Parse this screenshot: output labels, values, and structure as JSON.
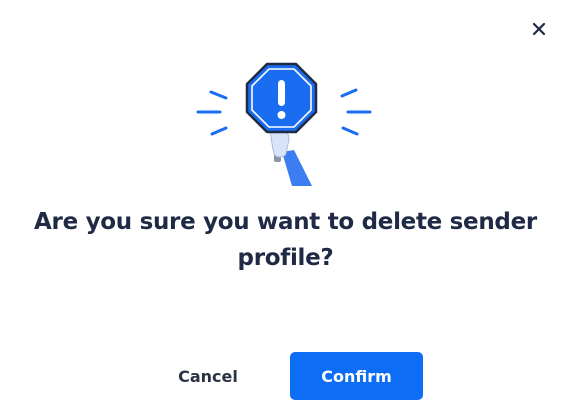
{
  "dialog": {
    "close_icon": "close-icon",
    "illustration_icon": "warning-stop-sign-icon",
    "message": "Are you sure you want to delete sender profile?",
    "cancel_label": "Cancel",
    "confirm_label": "Confirm"
  },
  "colors": {
    "primary": "#0d6ef5",
    "text_dark": "#1f2a44",
    "background": "#ffffff"
  }
}
